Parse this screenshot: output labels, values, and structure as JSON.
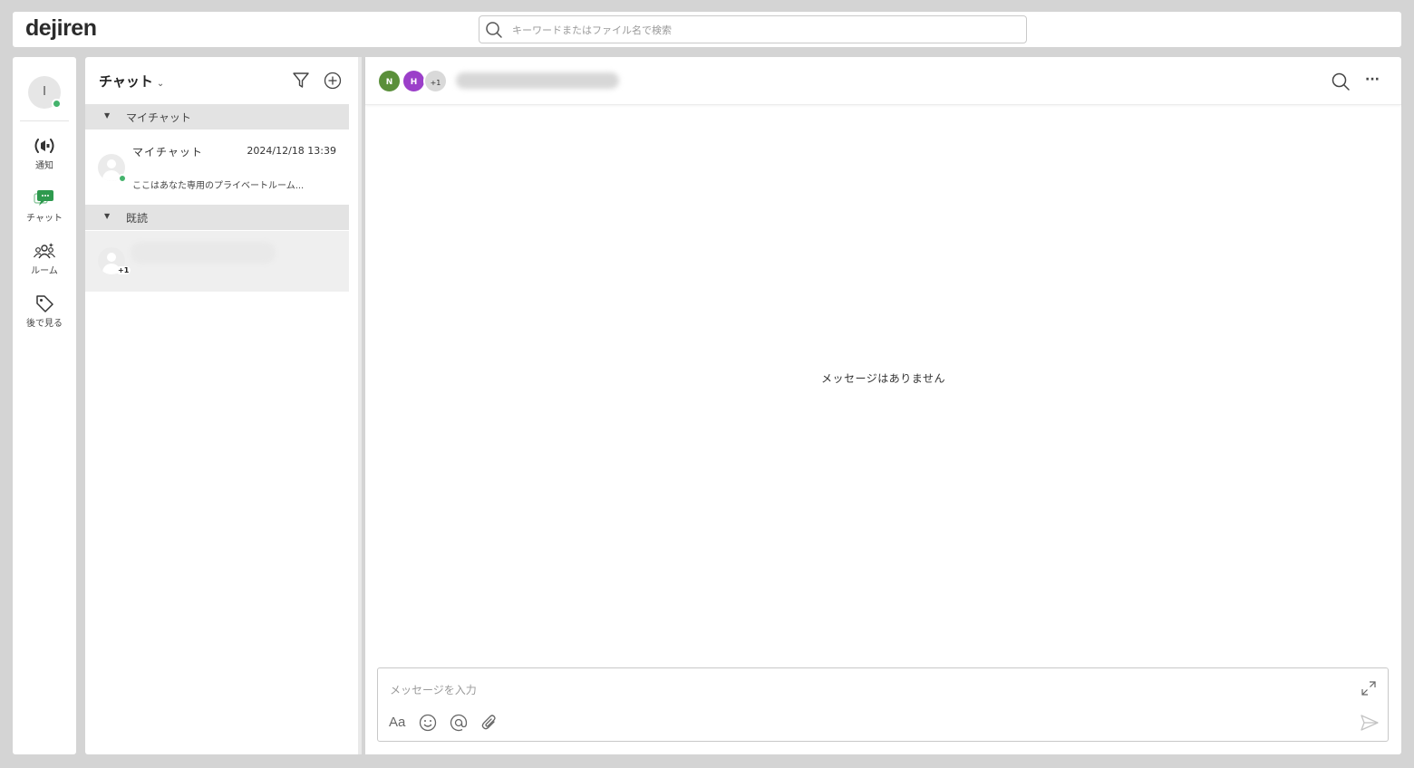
{
  "app": {
    "logo_text": "dejiren",
    "accent": "#2e9a4e",
    "online": "#44b36c"
  },
  "search": {
    "placeholder": "キーワードまたはファイル名で検索",
    "value": ""
  },
  "rail": {
    "me_initial": "I",
    "items": [
      {
        "label": "通知",
        "icon": "broadcast-icon"
      },
      {
        "label": "チャット",
        "icon": "chat-icon"
      },
      {
        "label": "ルーム",
        "icon": "people-icon"
      },
      {
        "label": "後で見る",
        "icon": "tag-icon"
      }
    ]
  },
  "chatlist": {
    "title": "チャット",
    "chevron": "⌄",
    "sections": [
      {
        "label": "マイチャット",
        "toggle": "▼"
      },
      {
        "label": "既読",
        "toggle": "▼"
      }
    ],
    "items": [
      {
        "name": "マイチャット",
        "time": "2024/12/18 13:39",
        "preview": "ここはあなた専用のプライベートルーム..."
      },
      {
        "badge": "+1"
      }
    ]
  },
  "main": {
    "members": [
      {
        "initial": "N",
        "color": "#5a8f3a"
      },
      {
        "initial": "H",
        "color": "#9b3fc9"
      },
      {
        "initial": "+1",
        "color": "#d9d9d9"
      }
    ],
    "more_label": "···",
    "empty_text": "メッセージはありません",
    "composer": {
      "placeholder": "メッセージを入力",
      "value": "",
      "format_label": "Aa"
    }
  }
}
